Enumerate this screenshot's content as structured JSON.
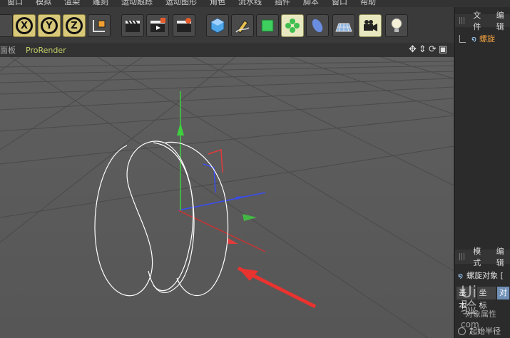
{
  "menu": {
    "items": [
      "窗口",
      "模拟",
      "渲染",
      "雕刻",
      "运动跟踪",
      "运动图形",
      "角色",
      "流水线",
      "插件",
      "脚本",
      "窗口",
      "帮助"
    ]
  },
  "toolbar": {
    "x_label": "X",
    "y_label": "Y",
    "z_label": "Z"
  },
  "viewport_header": {
    "left_label": "面板",
    "renderer": "ProRender",
    "icons": "✥⇕⟳▣"
  },
  "object_manager": {
    "tab_file": "文件",
    "tab_edit": "编辑",
    "object_name": "螺旋"
  },
  "attributes": {
    "tab_mode": "模式",
    "tab_edit": "编辑",
    "title": "螺旋对象 [",
    "tabs": [
      "基本",
      "坐标",
      "对"
    ],
    "section": "对象属性",
    "field_start_radius": "起始半径"
  },
  "watermark": {
    "line1": "Ui",
    "line2": "验",
    "line3": "com"
  },
  "colors": {
    "axis_x": "#e23b3b",
    "axis_y": "#3fcf3f",
    "axis_z": "#3a4cf0",
    "spline": "#ffffff",
    "arrow": "#e8332f"
  }
}
